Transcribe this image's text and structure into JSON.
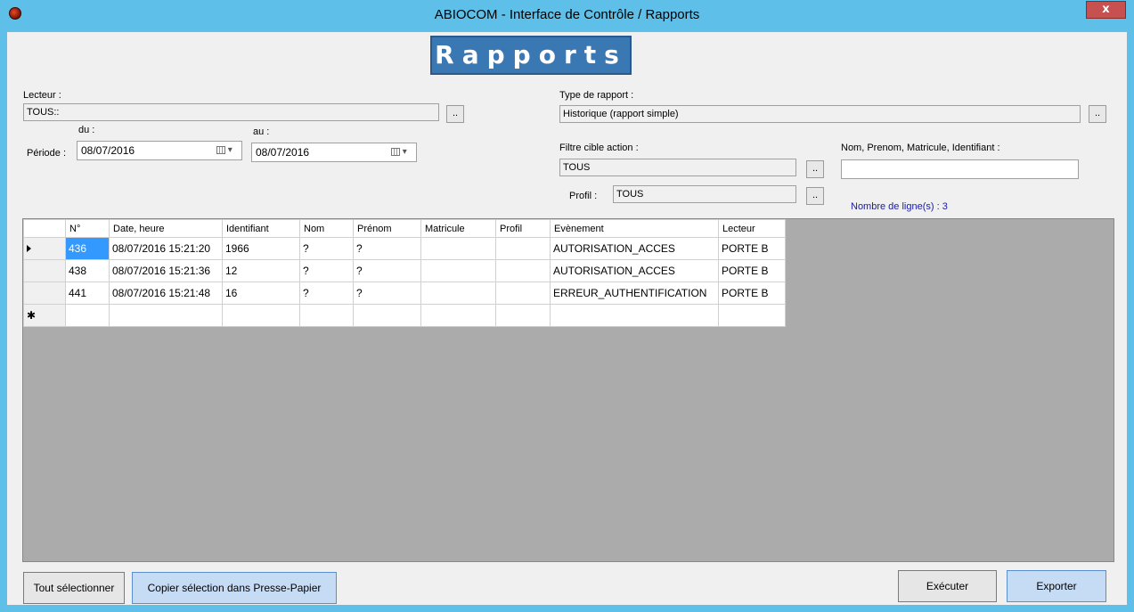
{
  "window": {
    "title": "ABIOCOM - Interface de Contrôle / Rapports",
    "close_label": "x"
  },
  "banner": "Rapports",
  "lecteur": {
    "label": "Lecteur :",
    "value": "TOUS::",
    "button": ".."
  },
  "periode": {
    "label": "Période :",
    "du_label": "du :",
    "au_label": "au :",
    "du_value": "08/07/2016",
    "au_value": "08/07/2016"
  },
  "type_rapport": {
    "label": "Type de rapport :",
    "value": "Historique (rapport simple)",
    "button": ".."
  },
  "filtre": {
    "label": "Filtre cible action :",
    "value": "TOUS",
    "button": ".."
  },
  "profil": {
    "label": "Profil :",
    "value": "TOUS",
    "button": ".."
  },
  "search": {
    "label": "Nom, Prenom, Matricule, Identifiant :",
    "value": ""
  },
  "row_count": "Nombre de ligne(s) : 3",
  "table": {
    "columns": [
      "N°",
      "Date, heure",
      "Identifiant",
      "Nom",
      "Prénom",
      "Matricule",
      "Profil",
      "Evènement",
      "Lecteur"
    ],
    "rows": [
      [
        "436",
        "08/07/2016 15:21:20",
        "1966",
        "?",
        "?",
        "",
        "",
        "AUTORISATION_ACCES",
        "PORTE B"
      ],
      [
        "438",
        "08/07/2016 15:21:36",
        "12",
        "?",
        "?",
        "",
        "",
        "AUTORISATION_ACCES",
        "PORTE B"
      ],
      [
        "441",
        "08/07/2016 15:21:48",
        "16",
        "?",
        "?",
        "",
        "",
        "ERREUR_AUTHENTIFICATION",
        "PORTE B"
      ]
    ],
    "new_row_marker": "✱"
  },
  "buttons": {
    "select_all": "Tout sélectionner",
    "copy": "Copier sélection dans Presse-Papier",
    "execute": "Exécuter",
    "export": "Exporter"
  }
}
